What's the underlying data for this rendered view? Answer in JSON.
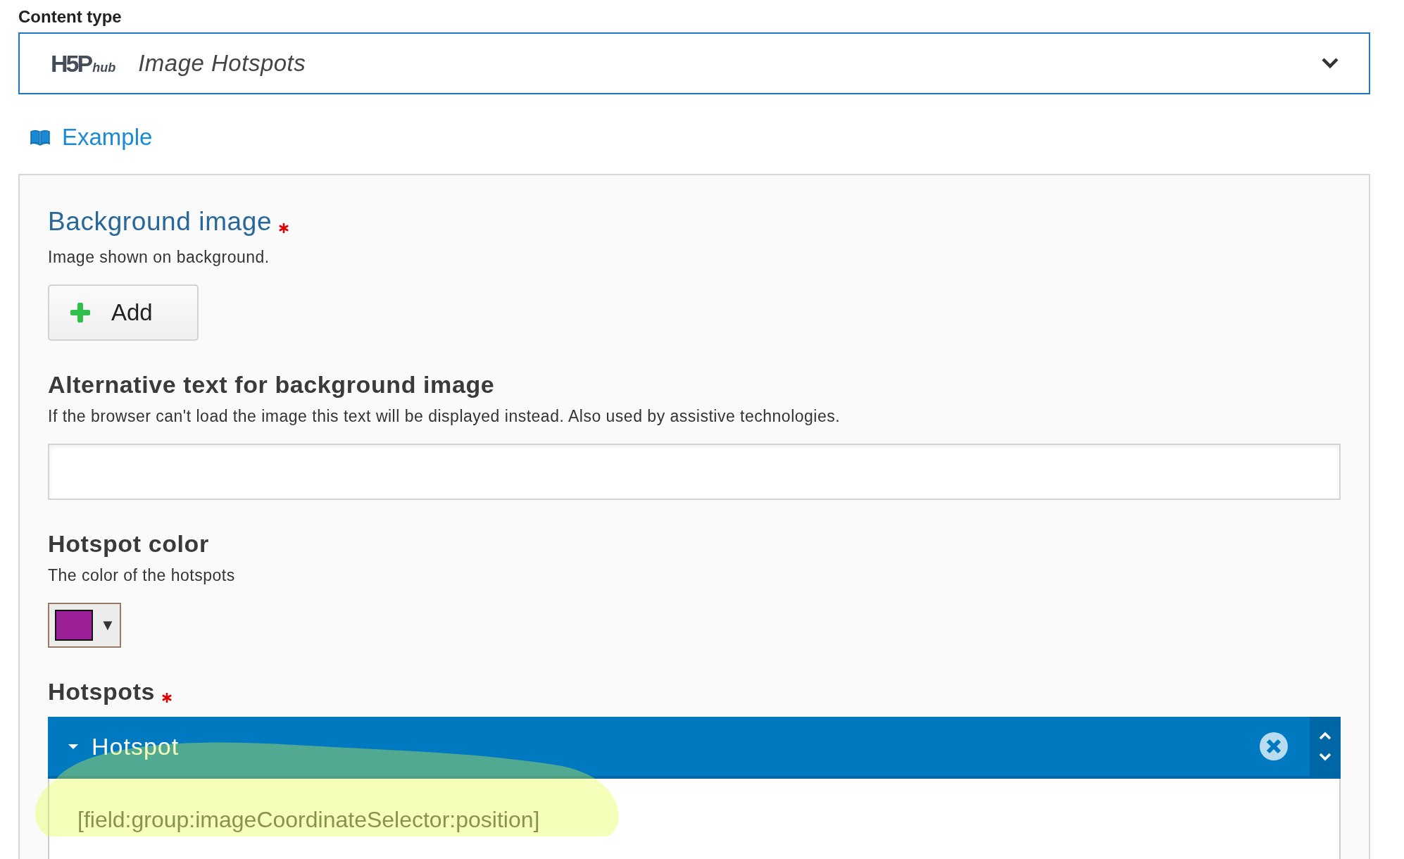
{
  "content_type": {
    "label": "Content type",
    "logo": {
      "mark": "H5P",
      "sub": "hub"
    },
    "value": "Image Hotspots",
    "expanded": false
  },
  "example_link": {
    "label": "Example"
  },
  "fields": [
    {
      "kind": "image",
      "label": "Background image",
      "required": true,
      "description": "Image shown on background.",
      "button": "Add"
    },
    {
      "kind": "text",
      "label": "Alternative text for background image",
      "required": false,
      "description": "If the browser can't load the image this text will be displayed instead. Also used by assistive technologies."
    },
    {
      "kind": "color",
      "label": "Hotspot color",
      "required": false,
      "description": "The color of the hotspots",
      "color": "#9b1f96",
      "caret": "▼"
    },
    {
      "kind": "list",
      "label": "Hotspots",
      "required": true,
      "items": [
        {
          "title": "Hotspot",
          "expanded": true,
          "body": "[field:group:imageCoordinateSelector:position]"
        }
      ]
    }
  ]
}
